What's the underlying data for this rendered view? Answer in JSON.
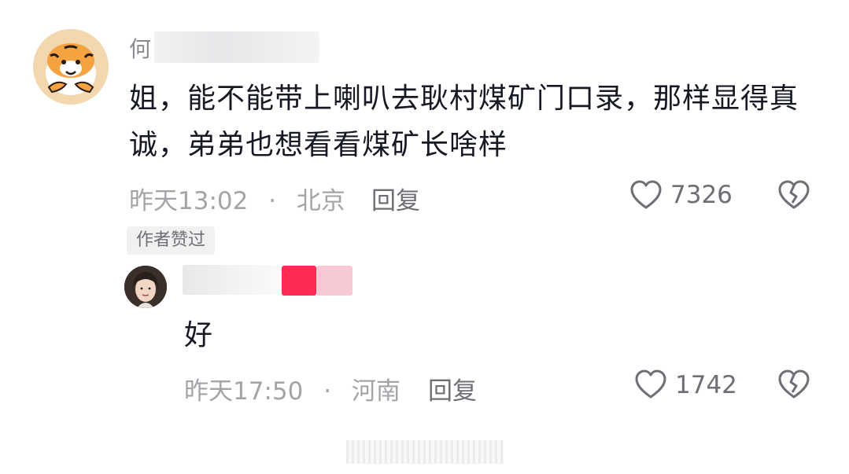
{
  "comment": {
    "username": "何",
    "text": "姐，能不能带上喇叭去耿村煤矿门口录，那样显得真诚，弟弟也想看看煤矿长啥样",
    "time": "昨天13:02",
    "location": "北京",
    "reply_label": "回复",
    "like_count": "7326",
    "badge": "作者赞过"
  },
  "reply": {
    "text": "好",
    "time": "昨天17:50",
    "location": "河南",
    "reply_label": "回复",
    "like_count": "1742"
  },
  "separator": "·",
  "colors": {
    "text": "#161823",
    "meta": "#a3a4a8",
    "secondary": "#6e6f75",
    "badge_bg": "#f1f1f2",
    "brand_pink": "#fe2c55"
  },
  "icons": [
    "heart-outline-icon",
    "broken-heart-icon"
  ]
}
